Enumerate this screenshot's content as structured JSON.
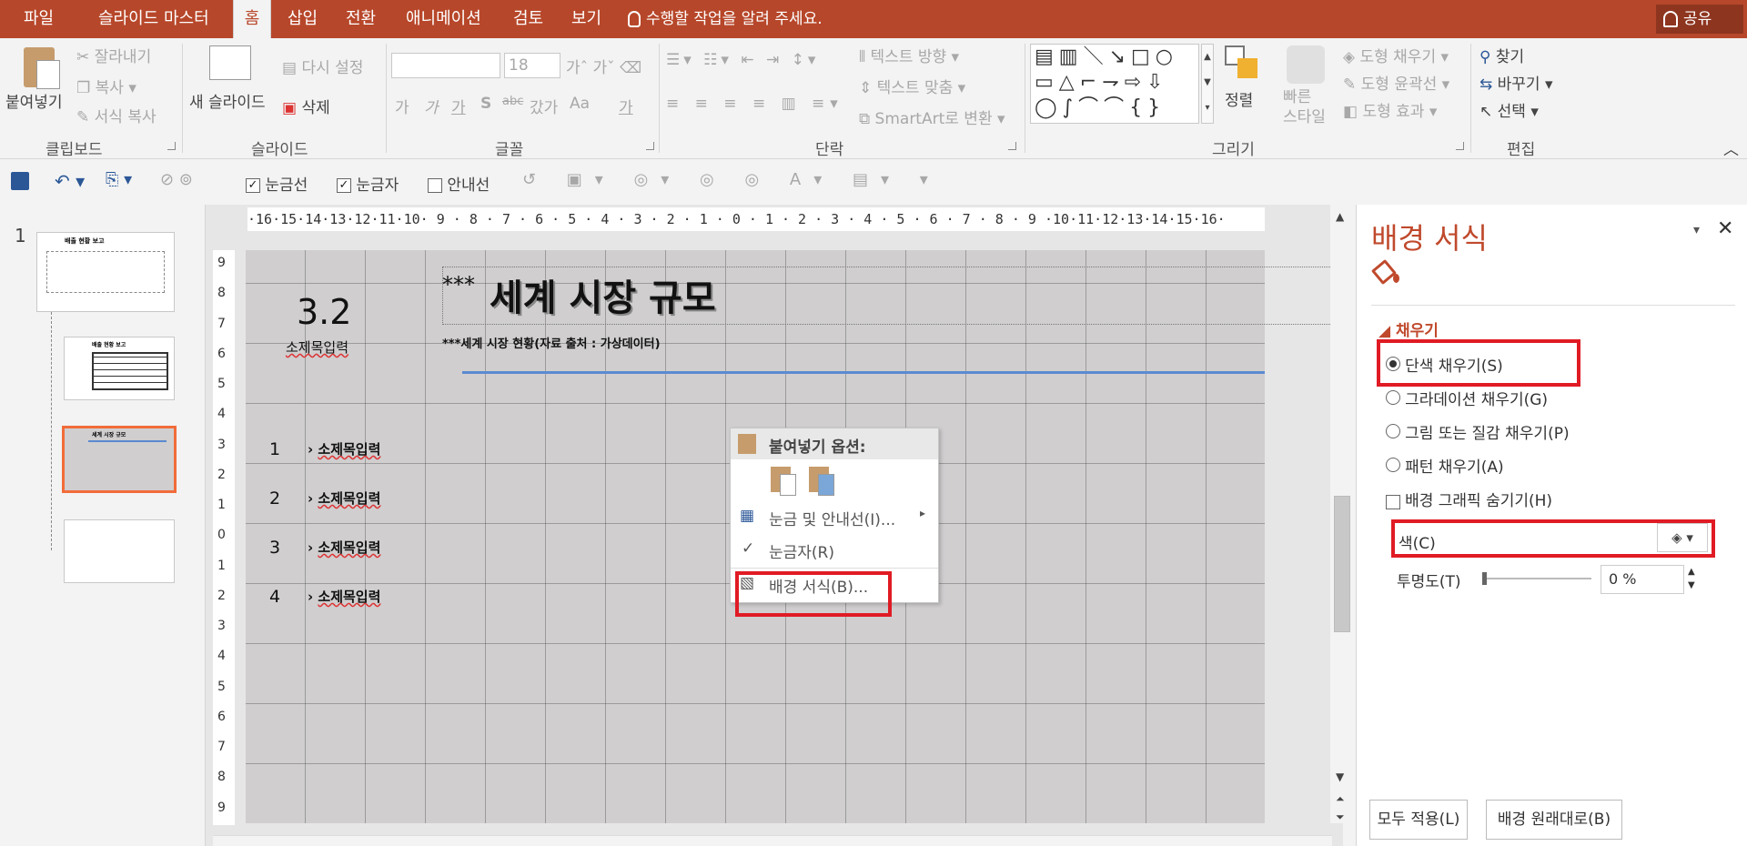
{
  "tabs": [
    {
      "label": "파일"
    },
    {
      "label": "슬라이드 마스터"
    },
    {
      "label": "홈"
    },
    {
      "label": "삽입"
    },
    {
      "label": "전환"
    },
    {
      "label": "애니메이션"
    },
    {
      "label": "검토"
    },
    {
      "label": "보기"
    }
  ],
  "tell_me": "수행할 작업을 알려 주세요.",
  "share": "공유",
  "ribbon": {
    "clipboard": {
      "paste": "붙여넣기",
      "cut": "잘라내기",
      "copy": "복사",
      "format_painter": "서식 복사",
      "label": "클립보드"
    },
    "slides": {
      "new_slide": "새 슬라이드",
      "reset": "다시 설정",
      "delete": "삭제",
      "label": "슬라이드"
    },
    "font": {
      "size": "18",
      "label": "글꼴",
      "s1": "가",
      "s2": "가",
      "s3": "가",
      "s4": "S",
      "s5": "abc",
      "s6": "갔가",
      "s7": "Aa",
      "s8": "가"
    },
    "paragraph": {
      "text_direction": "텍스트 방향",
      "align_text": "텍스트 맞춤",
      "smartart": "SmartArt로 변환",
      "label": "단락"
    },
    "drawing": {
      "arrange": "정렬",
      "quick_styles": "빠른\n스타일",
      "fill": "도형 채우기",
      "outline": "도형 윤곽선",
      "effects": "도형 효과",
      "label": "그리기"
    },
    "editing": {
      "find": "찾기",
      "replace": "바꾸기",
      "select": "선택",
      "label": "편집"
    }
  },
  "qat": {
    "gridlines": "눈금선",
    "ruler": "눈금자",
    "guides": "안내선",
    "gridlines_checked": true,
    "ruler_checked": true,
    "guides_checked": false
  },
  "thumbnails": [
    {
      "num": "1",
      "title": "배출 현황 보고"
    },
    {
      "title": "배출 현황 보고"
    },
    {
      "title": "세계 시장 규모"
    },
    {
      "title": ""
    }
  ],
  "ruler_h": "·16·15·14·13·12·11·10· 9 · 8 · 7 · 6 · 5 · 4 · 3 · 2 · 1 · 0 · 1 · 2 · 3 · 4 · 5 · 6 · 7 · 8 · 9 ·10·11·12·13·14·15·16·",
  "ruler_v": [
    "9",
    "8",
    "7",
    "6",
    "5",
    "4",
    "3",
    "2",
    "1",
    "0",
    "1",
    "2",
    "3",
    "4",
    "5",
    "6",
    "7",
    "8",
    "9"
  ],
  "slide": {
    "section_num": "3.2",
    "section_sub": "소제목입력",
    "title_prefix": "***",
    "title": "세계 시장 규모",
    "subtitle": "***세계 시장 현황(자료 출처 : 가상데이터)",
    "items": [
      {
        "num": "1",
        "text": "소제목입력"
      },
      {
        "num": "2",
        "text": "소제목입력"
      },
      {
        "num": "3",
        "text": "소제목입력"
      },
      {
        "num": "4",
        "text": "소제목입력"
      }
    ]
  },
  "context_menu": {
    "header": "붙여넣기 옵션:",
    "grid": "눈금 및 안내선(I)...",
    "ruler": "눈금자(R)",
    "bg_format": "배경 서식(B)..."
  },
  "panel": {
    "title": "배경 서식",
    "section": "채우기",
    "options": [
      {
        "label": "단색 채우기(S)",
        "selected": true
      },
      {
        "label": "그라데이션 채우기(G)",
        "selected": false
      },
      {
        "label": "그림 또는 질감 채우기(P)",
        "selected": false
      },
      {
        "label": "패턴 채우기(A)",
        "selected": false
      }
    ],
    "hide_graphics": "배경 그래픽 숨기기(H)",
    "color_label": "색(C)",
    "transparency_label": "투명도(T)",
    "transparency_value": "0 %",
    "apply_all": "모두 적용(L)",
    "reset_bg": "배경 원래대로(B)"
  },
  "colors": {
    "accent": "#b7472a",
    "highlight": "#e01b24",
    "slide_bg": "#d0cecf",
    "title_line": "#5b8ad0"
  }
}
